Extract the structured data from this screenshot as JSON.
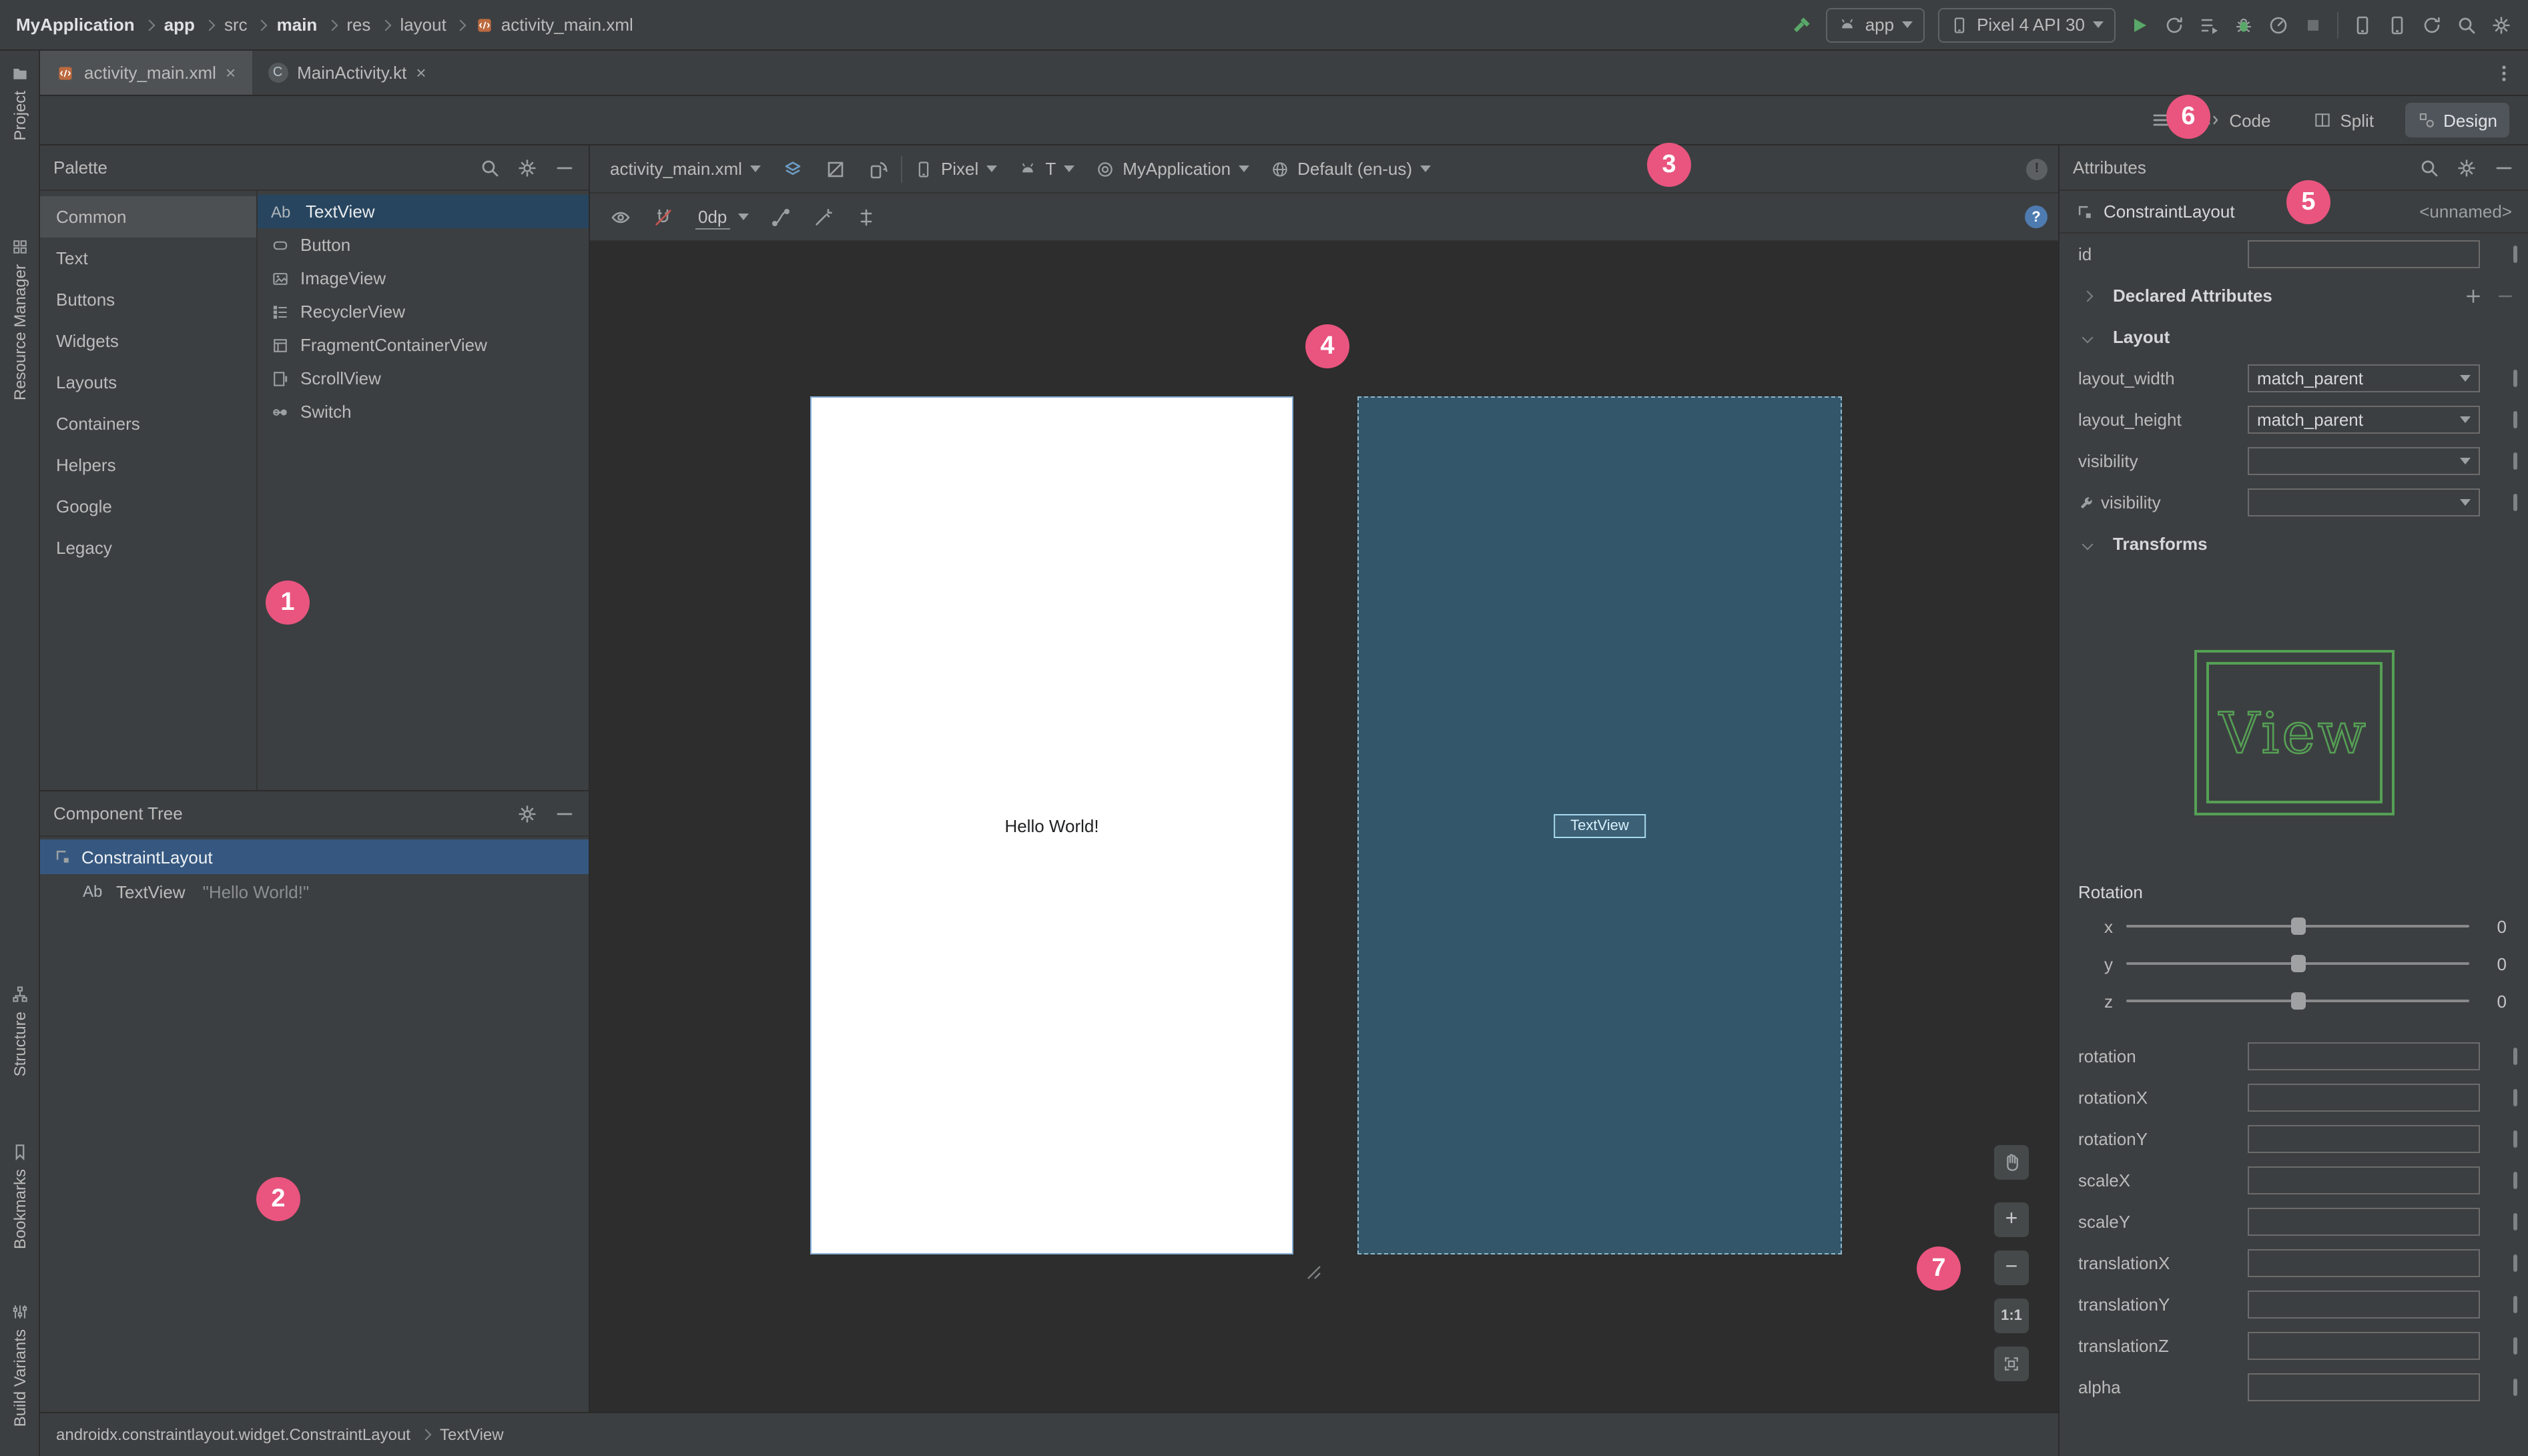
{
  "colors": {
    "panel_bg": "#3c3f41",
    "surface_bg": "#2d2d2d",
    "tab_active_bg": "#4e5254",
    "selection_blue": "#365880",
    "palette_selection": "#27455f",
    "blueprint_fill": "#33566b",
    "preview_green": "#55a055",
    "run_green": "#59a869",
    "badge_pink": "#e9557f"
  },
  "glyphs": {
    "close": "×",
    "help": "?",
    "info": "!",
    "class_c": "C",
    "ab": "Ab",
    "plus": "+",
    "minus": "−",
    "hand": "✋"
  },
  "topbar": {
    "breadcrumbs": [
      "MyApplication",
      "app",
      "src",
      "main",
      "res",
      "layout",
      "activity_main.xml"
    ],
    "run_config": "app",
    "device": "Pixel 4 API 30"
  },
  "tabs": [
    {
      "label": "activity_main.xml"
    },
    {
      "label": "MainActivity.kt"
    }
  ],
  "left_strip": [
    "Project",
    "Resource Manager",
    "Structure",
    "Bookmarks",
    "Build Variants"
  ],
  "mode_toggle": {
    "items": [
      "Code",
      "Split",
      "Design"
    ],
    "active": "Design"
  },
  "palette": {
    "title": "Palette",
    "categories": [
      "Common",
      "Text",
      "Buttons",
      "Widgets",
      "Layouts",
      "Containers",
      "Helpers",
      "Google",
      "Legacy"
    ],
    "active_category": "Common",
    "components": [
      "TextView",
      "Button",
      "ImageView",
      "RecyclerView",
      "FragmentContainerView",
      "ScrollView",
      "Switch"
    ],
    "selected_component": "TextView"
  },
  "component_tree": {
    "title": "Component Tree",
    "root": "ConstraintLayout",
    "child": "TextView",
    "child_detail": "\"Hello World!\""
  },
  "design_toolbar": {
    "file": "activity_main.xml",
    "device": "Pixel",
    "api": "T",
    "theme": "MyApplication",
    "locale": "Default (en-us)",
    "margin": "0dp"
  },
  "surface": {
    "design_text": "Hello World!",
    "blueprint_component": "TextView"
  },
  "zoom": {
    "ratio": "1:1",
    "zoom_in": "+",
    "zoom_out": "−"
  },
  "attributes": {
    "title": "Attributes",
    "component": "ConstraintLayout",
    "component_id": "<unnamed>",
    "id_label": "id",
    "id_value": "",
    "declared_section": "Declared Attributes",
    "layout_section": "Layout",
    "transforms_section": "Transforms",
    "layout_rows": [
      {
        "label": "layout_width",
        "value": "match_parent"
      },
      {
        "label": "layout_height",
        "value": "match_parent"
      },
      {
        "label": "visibility",
        "value": ""
      },
      {
        "label": "visibility",
        "value": ""
      }
    ],
    "preview_text": "View",
    "rotation_label": "Rotation",
    "sliders": [
      {
        "axis": "x",
        "value": "0"
      },
      {
        "axis": "y",
        "value": "0"
      },
      {
        "axis": "z",
        "value": "0"
      }
    ],
    "transform_fields": [
      "rotation",
      "rotationX",
      "rotationY",
      "scaleX",
      "scaleY",
      "translationX",
      "translationY",
      "translationZ",
      "alpha"
    ]
  },
  "editor_breadcrumb": {
    "path": "androidx.constraintlayout.widget.ConstraintLayout",
    "child": "TextView"
  },
  "annotations": [
    "1",
    "2",
    "3",
    "4",
    "5",
    "6",
    "7"
  ]
}
